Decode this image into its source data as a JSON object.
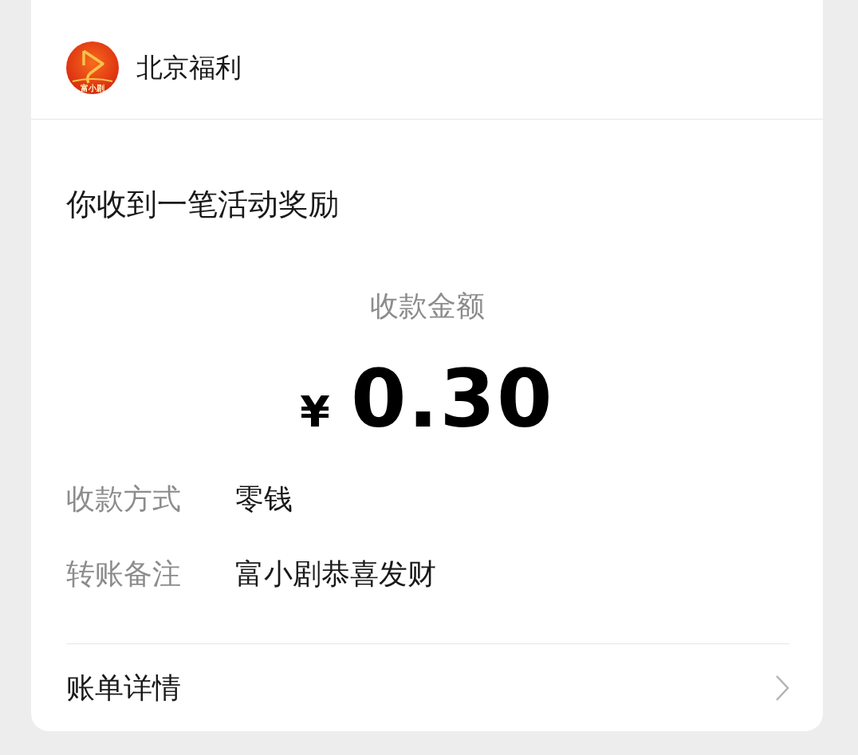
{
  "header": {
    "logo_text": "富小剧",
    "title": "北京福利"
  },
  "message": "你收到一笔活动奖励",
  "amount": {
    "label": "收款金额",
    "currency": "¥",
    "value": "0.30"
  },
  "details": [
    {
      "label": "收款方式",
      "value": "零钱"
    },
    {
      "label": "转账备注",
      "value": "富小剧恭喜发财"
    }
  ],
  "footer": {
    "label": "账单详情"
  }
}
